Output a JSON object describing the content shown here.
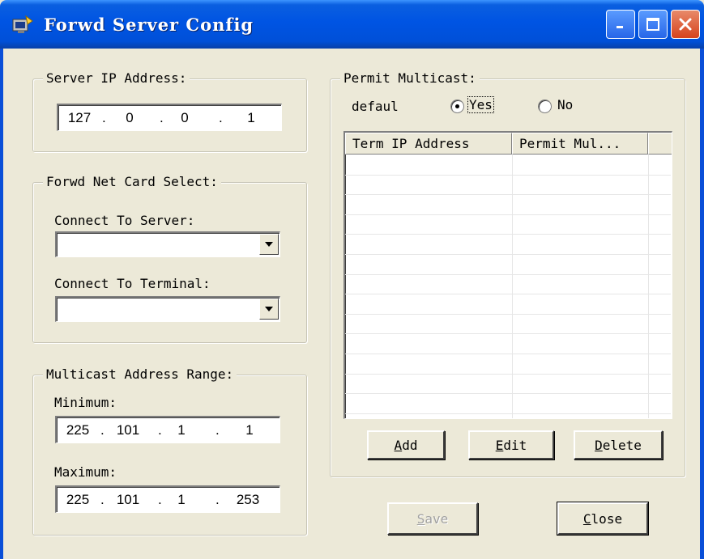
{
  "window": {
    "title": "Forwd Server Config"
  },
  "server_ip": {
    "group_title": "Server IP Address:",
    "octets": [
      "127",
      "0",
      "0",
      "1"
    ]
  },
  "net_card": {
    "group_title": "Forwd Net Card Select:",
    "server_label": "Connect To Server:",
    "server_value": "",
    "terminal_label": "Connect To Terminal:",
    "terminal_value": ""
  },
  "multicast_range": {
    "group_title": "Multicast Address Range:",
    "min_label": "Minimum:",
    "min_octets": [
      "225",
      "101",
      "1",
      "1"
    ],
    "max_label": "Maximum:",
    "max_octets": [
      "225",
      "101",
      "1",
      "253"
    ]
  },
  "permit_multicast": {
    "group_title": "Permit Multicast:",
    "default_label": "defaul",
    "yes_label": "Yes",
    "no_label": "No",
    "selected": "Yes",
    "columns": [
      "Term IP Address",
      "Permit Mul..."
    ],
    "rows": []
  },
  "buttons": {
    "add": {
      "mnemonic": "A",
      "rest": "dd"
    },
    "edit": {
      "mnemonic": "E",
      "rest": "dit"
    },
    "delete": {
      "mnemonic": "D",
      "rest": "elete"
    },
    "save": {
      "mnemonic": "S",
      "rest": "ave"
    },
    "close": {
      "mnemonic": "C",
      "rest": "lose"
    }
  },
  "colors": {
    "titlebar": "#0054e3",
    "face": "#ece9d8",
    "close_button": "#d6431c"
  }
}
